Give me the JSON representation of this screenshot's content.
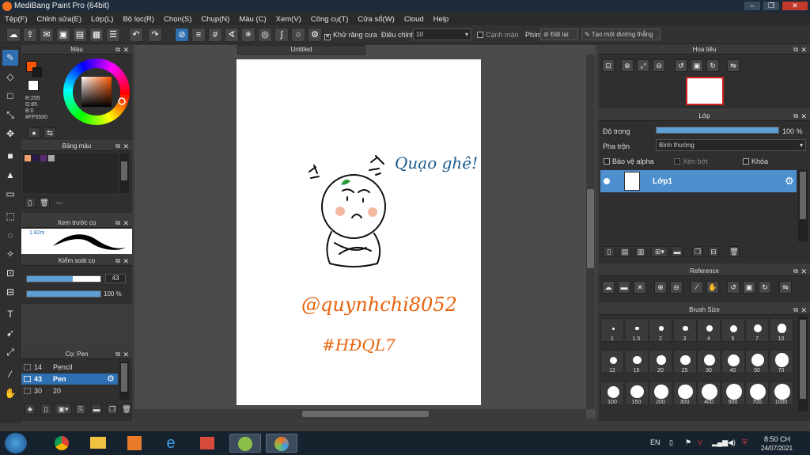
{
  "window": {
    "title": "MediBang Paint Pro (64bit)"
  },
  "menu": [
    "Tệp(F)",
    "Chỉnh sửa(E)",
    "Lớp(L)",
    "Bộ lọc(R)",
    "Chọn(S)",
    "Chụp(N)",
    "Màu (C)",
    "Xem(V)",
    "Công cụ(T)",
    "Cửa sổ(W)",
    "Cloud",
    "Help"
  ],
  "toolbar": {
    "antialias_label": "Khử răng cưa",
    "adjust_label": "Điều chỉnh",
    "adjust_value": "10",
    "ruler_label": "Cạnh màn",
    "key_label": "Phím",
    "reset_label": "Đặt lại",
    "line_label": "Tạo một đường thẳng"
  },
  "color_panel": {
    "title": "Màu",
    "r": "R:255",
    "g": "G:85",
    "b": "B:0",
    "hex": "#FF5500",
    "primary_color": "#ff5500",
    "secondary_color": "#ffffff"
  },
  "palette_panel": {
    "title": "Bảng màu",
    "swatches": [
      "#f0a070",
      "#2a1a50",
      "#5a2a70",
      "#a8a8a8"
    ],
    "name": "---"
  },
  "brush_preview": {
    "title": "Xem trước cọ",
    "size_label": "1.82m"
  },
  "brush_control": {
    "title": "Kiểm soát cọ",
    "size": "43",
    "size_fraction": 0.62,
    "opacity": "100 %",
    "opacity_fraction": 1.0
  },
  "brush_list": {
    "title": "Cọ: Pen",
    "items": [
      {
        "size": "14",
        "name": "Pencil"
      },
      {
        "size": "43",
        "name": "Pen"
      },
      {
        "size": "30",
        "name": "20"
      }
    ]
  },
  "canvas": {
    "tab": "Untitled"
  },
  "artwork": {
    "text1": "Quạo ghê!",
    "text2": "@quynhchi8052",
    "text3": "#HĐQL7"
  },
  "navigator": {
    "title": "Hoa tiêu"
  },
  "layer_panel": {
    "title": "Lớp",
    "opacity_label": "Độ trong",
    "opacity_value": "100 %",
    "opacity_fraction": 1.0,
    "blend_label": "Pha trộn",
    "blend_value": "Bình thường",
    "protect_alpha": "Bảo vệ alpha",
    "clipping": "Xén bớt",
    "lock": "Khóa",
    "layer_name": "Lớp1"
  },
  "reference_panel": {
    "title": "Reference"
  },
  "brush_size_panel": {
    "title": "Brush Size",
    "sizes": [
      "1",
      "1.5",
      "2",
      "3",
      "4",
      "5",
      "7",
      "10",
      "12",
      "15",
      "20",
      "25",
      "30",
      "40",
      "50",
      "70",
      "100",
      "150",
      "200",
      "300",
      "400",
      "500",
      "700",
      "1000"
    ]
  },
  "taskbar": {
    "language": "EN",
    "time": "8:50 CH",
    "date": "24/07/2021"
  }
}
